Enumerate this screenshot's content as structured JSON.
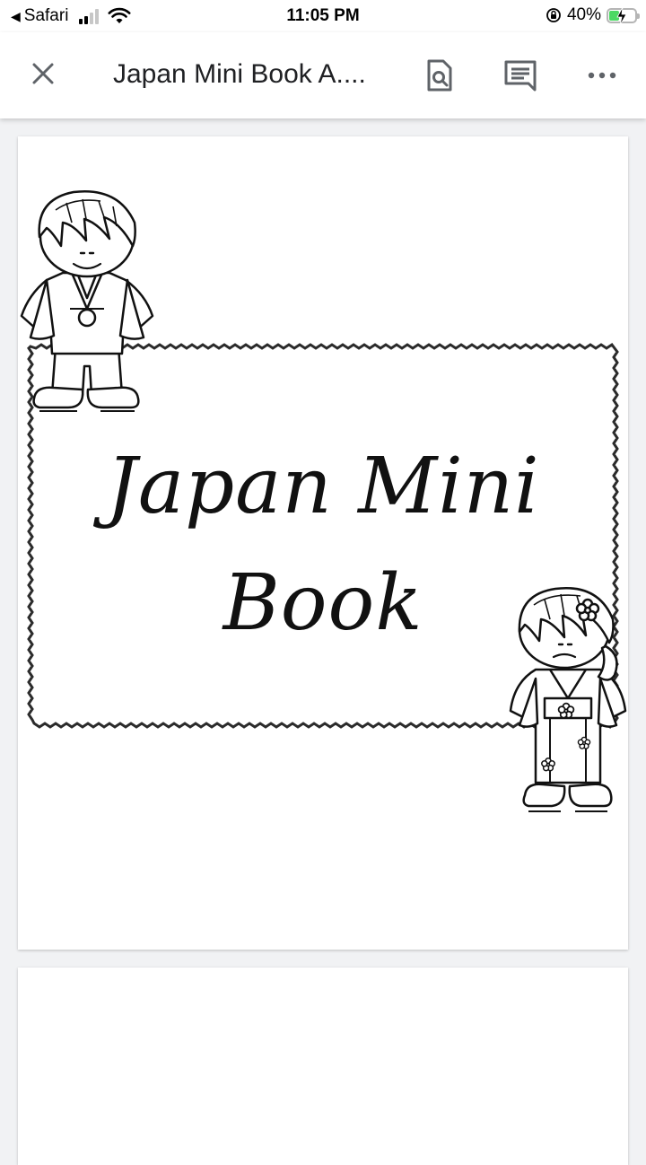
{
  "status_bar": {
    "back_app": "Safari",
    "time": "11:05 PM",
    "battery_percent": "40%",
    "battery_level": 0.4
  },
  "toolbar": {
    "title": "Japan Mini Book A....",
    "close_icon": "close-icon",
    "find_icon": "find-in-page-icon",
    "comment_icon": "comment-icon",
    "more_icon": "more-horizontal-icon"
  },
  "document": {
    "title_line_1": "Japan Mini",
    "title_line_2": "Book",
    "colors": {
      "border": "#2b2b2b",
      "background": "#f1f2f4",
      "battery": "#4cd964"
    }
  }
}
